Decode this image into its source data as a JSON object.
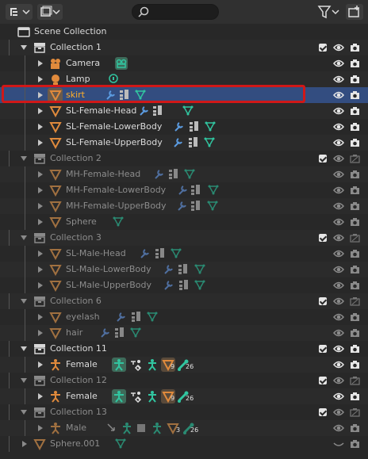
{
  "toolbar": {
    "display_mode_icon": "outliner-display-mode-icon",
    "filter_icon": "filter-icon",
    "new_collection_icon": "new-collection-icon",
    "search_placeholder": ""
  },
  "tree": [
    {
      "label": "Scene Collection",
      "type": "scene",
      "depth": 0
    },
    {
      "label": "Collection 1",
      "type": "collection",
      "depth": 1,
      "open": true,
      "checkbox": true
    },
    {
      "label": "Camera",
      "type": "camera",
      "depth": 2,
      "closed": true
    },
    {
      "label": "Lamp",
      "type": "lamp",
      "depth": 2,
      "closed": true
    },
    {
      "label": "skirt",
      "type": "mesh",
      "depth": 2,
      "closed": true,
      "selected": true
    },
    {
      "label": "SL-Female-Head",
      "type": "mesh",
      "depth": 2,
      "closed": true
    },
    {
      "label": "SL-Female-LowerBody",
      "type": "mesh",
      "depth": 2,
      "closed": true
    },
    {
      "label": "SL-Female-UpperBody",
      "type": "mesh",
      "depth": 2,
      "closed": true
    },
    {
      "label": "Collection 2",
      "type": "collection",
      "depth": 1,
      "open": true,
      "dim": true,
      "checkbox": true
    },
    {
      "label": "MH-Female-Head",
      "type": "mesh",
      "depth": 2,
      "closed": true,
      "dim": true
    },
    {
      "label": "MH-Female-LowerBody",
      "type": "mesh",
      "depth": 2,
      "closed": true,
      "dim": true
    },
    {
      "label": "MH-Female-UpperBody",
      "type": "mesh",
      "depth": 2,
      "closed": true,
      "dim": true
    },
    {
      "label": "Sphere",
      "type": "mesh",
      "depth": 2,
      "closed": true,
      "dim": true
    },
    {
      "label": "Collection 3",
      "type": "collection",
      "depth": 1,
      "open": true,
      "dim": true,
      "checkbox": true
    },
    {
      "label": "SL-Male-Head",
      "type": "mesh",
      "depth": 2,
      "closed": true,
      "dim": true
    },
    {
      "label": "SL-Male-LowerBody",
      "type": "mesh",
      "depth": 2,
      "closed": true,
      "dim": true
    },
    {
      "label": "SL-Male-UpperBody",
      "type": "mesh",
      "depth": 2,
      "closed": true,
      "dim": true
    },
    {
      "label": "Collection 6",
      "type": "collection",
      "depth": 1,
      "open": true,
      "dim": true,
      "checkbox": true
    },
    {
      "label": "eyelash",
      "type": "mesh",
      "depth": 2,
      "closed": true,
      "dim": true
    },
    {
      "label": "hair",
      "type": "mesh",
      "depth": 2,
      "closed": true,
      "dim": true
    },
    {
      "label": "Collection 11",
      "type": "collection",
      "depth": 1,
      "open": true,
      "checkbox": true
    },
    {
      "label": "Female",
      "type": "armature",
      "depth": 2,
      "closed": true,
      "counts": [
        "9",
        "26"
      ]
    },
    {
      "label": "Collection 12",
      "type": "collection",
      "depth": 1,
      "open": true,
      "dim": true,
      "checkbox": true
    },
    {
      "label": "Female",
      "type": "armature",
      "depth": 2,
      "closed": true,
      "counts": [
        "9",
        "26"
      ]
    },
    {
      "label": "Collection 13",
      "type": "collection",
      "depth": 1,
      "open": true,
      "dim": true,
      "checkbox": true
    },
    {
      "label": "Male",
      "type": "armature",
      "depth": 2,
      "closed": true,
      "dim": true,
      "counts": [
        "3",
        "26"
      ]
    },
    {
      "label": "Sphere.001",
      "type": "mesh",
      "depth": 1,
      "closed": true,
      "dim": true
    }
  ],
  "colors": {
    "selected_row": "#334d80",
    "mesh": "#e08a3c",
    "modifier": "#5b9be0",
    "data": "#31c5a0",
    "highlight_box": "#d01818",
    "selected_text": "#ffaf29"
  }
}
